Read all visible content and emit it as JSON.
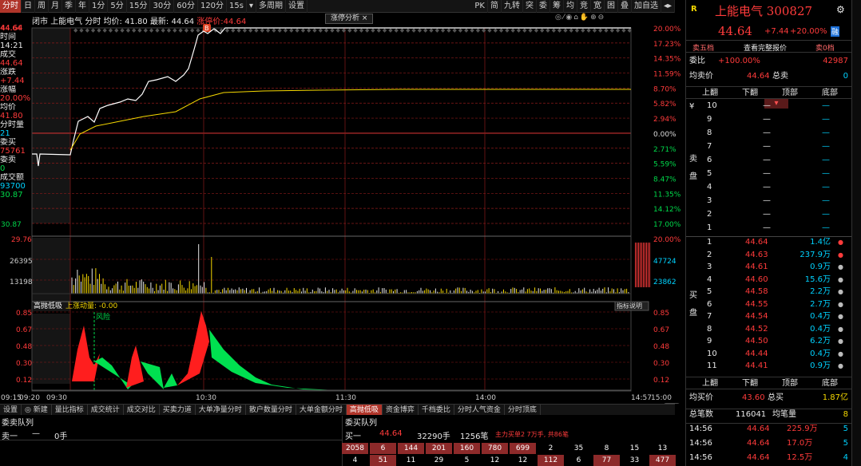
{
  "topbar": {
    "tabs": [
      "分时",
      "日",
      "周",
      "月",
      "季",
      "年",
      "1分",
      "5分",
      "15分",
      "30分",
      "60分",
      "120分",
      "15s",
      "▾",
      "多周期",
      "设置"
    ],
    "right_tabs": [
      "PK",
      "简",
      "九转",
      "突",
      "委",
      "筹",
      "均",
      "竞",
      "宽",
      "困",
      "叠",
      "加自选",
      "◂▸"
    ]
  },
  "chart_info": {
    "market": "闭市",
    "name": "上能电气",
    "type": "分时",
    "avg_label": "均价: 41.80",
    "latest_label": "最新: 44.64",
    "limit_label": "涨停价:44.64",
    "tag": "涨停分析",
    "tag_close": "×",
    "toolbar_icons": "◎⁄◉⌂✋⊕⊖"
  },
  "left_panel": [
    {
      "label": "44.64",
      "color": "r"
    },
    {
      "label": "时间",
      "color": "w"
    },
    {
      "label": "14:21",
      "color": "w"
    },
    {
      "label": "成交",
      "color": "w"
    },
    {
      "label": "44.64",
      "color": "r"
    },
    {
      "label": "涨跌",
      "color": "w"
    },
    {
      "label": "+7.44",
      "color": "r"
    },
    {
      "label": "涨幅",
      "color": "w"
    },
    {
      "label": "20.00%",
      "color": "r"
    },
    {
      "label": "均价",
      "color": "w"
    },
    {
      "label": "41.80",
      "color": "r"
    },
    {
      "label": "分时量",
      "color": "w"
    },
    {
      "label": "21",
      "color": "c"
    },
    {
      "label": "委买",
      "color": "w"
    },
    {
      "label": "75761",
      "color": "r"
    },
    {
      "label": "委卖",
      "color": "w"
    },
    {
      "label": "0",
      "color": "g"
    },
    {
      "label": "成交额",
      "color": "w"
    },
    {
      "label": "93700",
      "color": "c"
    },
    {
      "label": "30.87",
      "color": "g"
    }
  ],
  "price_axis_left": [
    "44.64",
    "",
    "",
    "",
    "",
    "",
    "",
    "",
    "",
    "",
    "",
    "",
    "",
    "30.87"
  ],
  "pct_axis": [
    "20.00%",
    "17.23%",
    "14.35%",
    "11.59%",
    "8.70%",
    "5.82%",
    "2.94%",
    "0.00%",
    "2.71%",
    "5.59%",
    "8.47%",
    "11.35%",
    "14.12%",
    "17.00%"
  ],
  "vol_axis_left": [
    "29.76",
    "26395",
    "13198"
  ],
  "vol_axis_right": [
    "20.00%",
    "47724",
    "23862"
  ],
  "indicator": {
    "name": "高抛低吸",
    "line_label": "上涨动量: -0.00",
    "risk_label": "风险",
    "explain": "指标说明",
    "levels": [
      "0.85",
      "0.67",
      "0.48",
      "0.30",
      "0.12"
    ]
  },
  "time_axis": [
    "09:15",
    "09:20",
    "09:30",
    "10:30",
    "11:30",
    "14:00",
    "14:57",
    "15:00"
  ],
  "bottom_tabs": [
    "设置",
    "◎ 新建",
    "量比指标",
    "成交统计",
    "成交对比",
    "买卖力道",
    "大单净量分时",
    "散户数量分时",
    "大单金额分时",
    "高抛低吸",
    "资金博弈",
    "千档委比",
    "分时人气资金",
    "分时顶底"
  ],
  "queue": {
    "left_title": "委卖队列",
    "left_row_label": "卖一",
    "left_row_dash": "—",
    "left_row_value": "0手",
    "right_title": "委买队列",
    "buy1_label": "买一",
    "buy1_price": "44.64",
    "buy1_vol": "32290手",
    "buy1_count": "1256笔",
    "buy1_note": "主力买单2 7万手, 共86笔",
    "row1": [
      "2058",
      "6",
      "144",
      "201",
      "160",
      "780",
      "699",
      "2",
      "35",
      "8",
      "15",
      "13"
    ],
    "row2": [
      "4",
      "51",
      "11",
      "29",
      "5",
      "12",
      "12",
      "112",
      "6",
      "77",
      "33",
      "477"
    ]
  },
  "quote": {
    "prefix": "R",
    "name": "上能电气",
    "code": "300827",
    "price": "44.64",
    "change": "+7.44",
    "pct": "+20.00%",
    "badge": "融",
    "btn_sell": "卖五档",
    "btn_full": "查看完整报价",
    "btn_sell0": "卖0档",
    "wb_label": "委比",
    "wb_value": "+100.00%",
    "wb_diff": "42987",
    "avg_sell_label": "均卖价",
    "avg_sell_value": "44.64",
    "total_sell_label": "总卖",
    "total_sell_value": "0",
    "nav": [
      "上翻",
      "下翻",
      "顶部",
      "底部"
    ],
    "sell_side_label": [
      "卖",
      "盘"
    ],
    "sell_levels": [
      "10",
      "9",
      "8",
      "7",
      "6",
      "5",
      "4",
      "3",
      "2",
      "1"
    ],
    "dash": "—",
    "buy_side_label": [
      "买",
      "盘"
    ],
    "buy_levels": [
      {
        "n": "1",
        "p": "44.64",
        "v": "1.4亿"
      },
      {
        "n": "2",
        "p": "44.63",
        "v": "237.9万"
      },
      {
        "n": "3",
        "p": "44.61",
        "v": "0.9万"
      },
      {
        "n": "4",
        "p": "44.60",
        "v": "15.6万"
      },
      {
        "n": "5",
        "p": "44.58",
        "v": "2.2万"
      },
      {
        "n": "6",
        "p": "44.55",
        "v": "2.7万"
      },
      {
        "n": "7",
        "p": "44.54",
        "v": "0.4万"
      },
      {
        "n": "8",
        "p": "44.52",
        "v": "0.4万"
      },
      {
        "n": "9",
        "p": "44.50",
        "v": "6.2万"
      },
      {
        "n": "10",
        "p": "44.44",
        "v": "0.4万"
      },
      {
        "n": "11",
        "p": "44.41",
        "v": "0.9万"
      }
    ],
    "avg_buy_label": "均买价",
    "avg_buy_value": "43.60",
    "total_buy_label": "总买",
    "total_buy_value": "1.87亿",
    "total_count_label": "总笔数",
    "total_count_value": "116041",
    "avg_count_label": "均笔量",
    "avg_count_value": "8",
    "ticks": [
      {
        "t": "14:56",
        "p": "44.64",
        "v": "225.9万",
        "n": "5"
      },
      {
        "t": "14:56",
        "p": "44.64",
        "v": "17.0万",
        "n": "5"
      },
      {
        "t": "14:56",
        "p": "44.64",
        "v": "12.5万",
        "n": "4"
      }
    ],
    "settings_icon": "⚙"
  },
  "colors": {
    "up": "#ff3b3b",
    "down": "#00d84a",
    "price_line": "#ffffff",
    "avg_line": "#f5d800",
    "grid": "#8b1a1a"
  }
}
